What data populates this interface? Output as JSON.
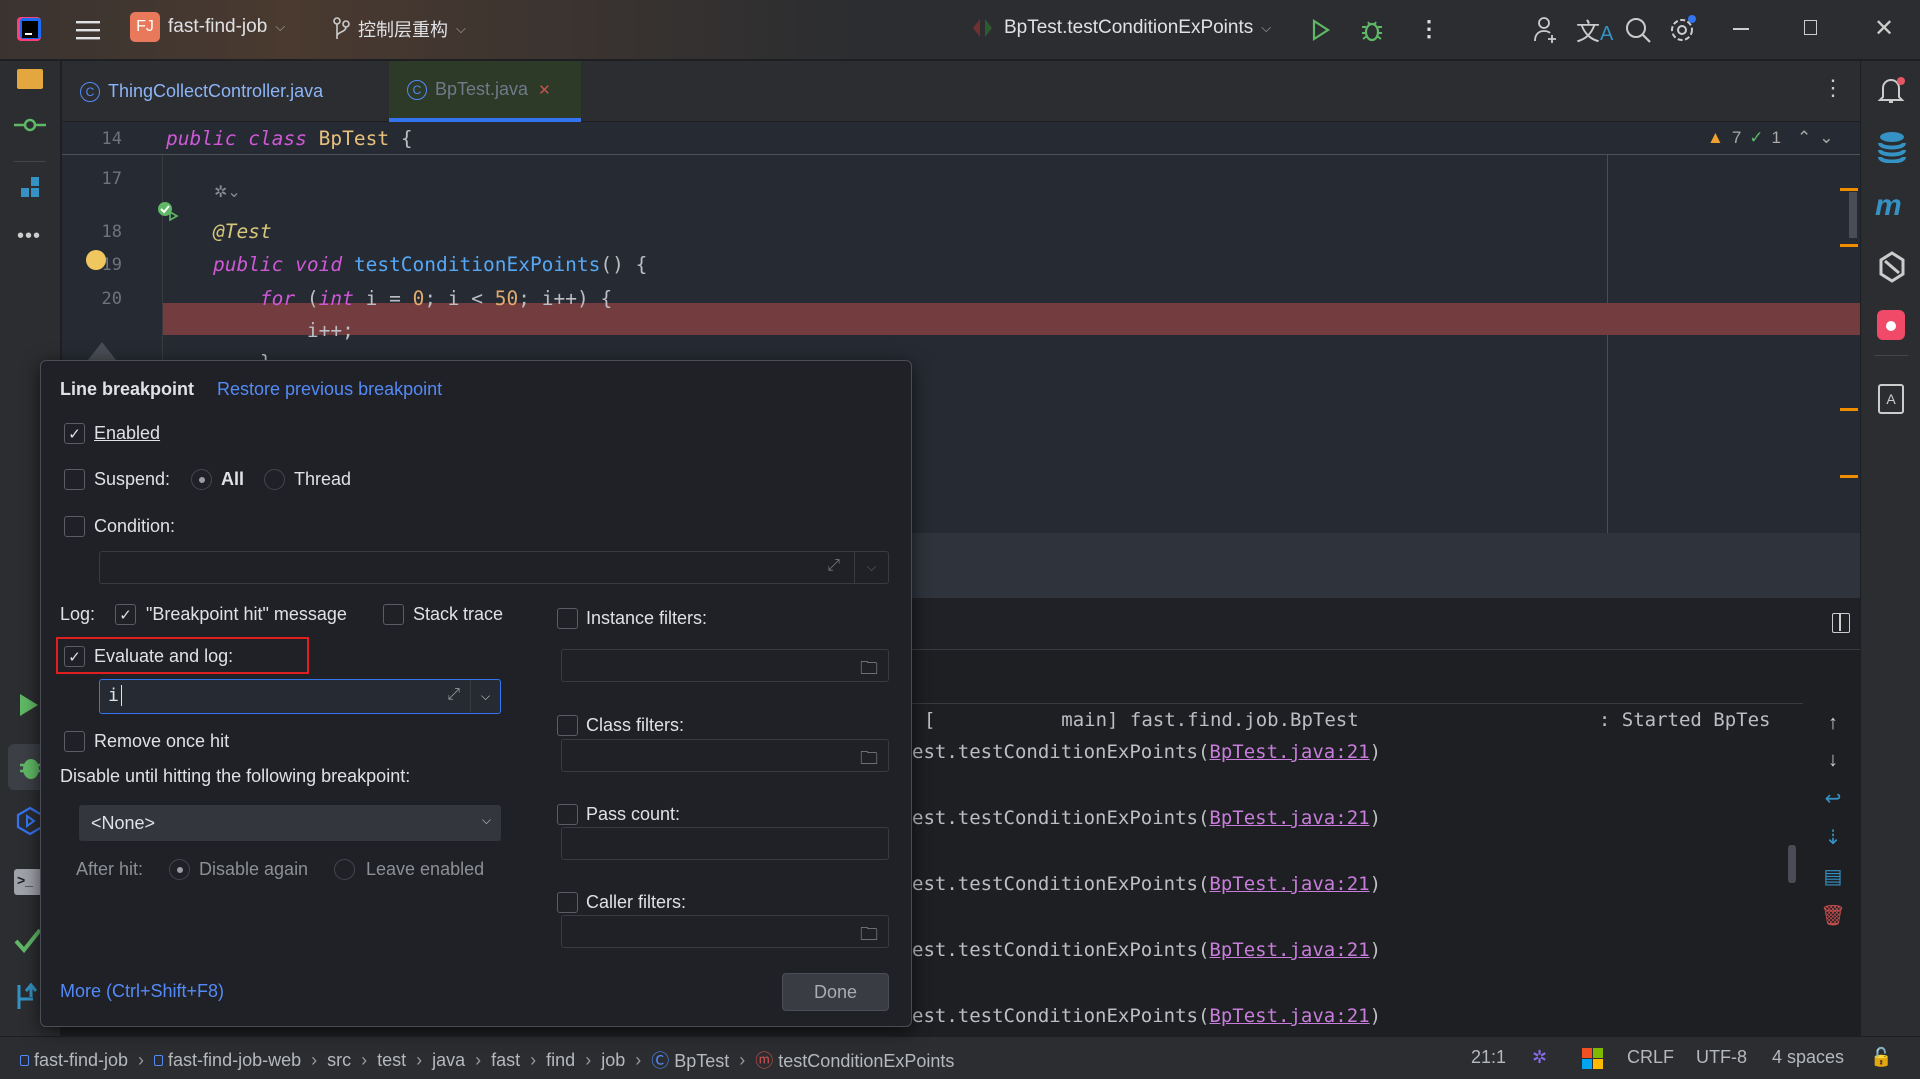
{
  "titlebar": {
    "project_badge": "FJ",
    "project_name": "fast-find-job",
    "branch": "控制层重构",
    "run_config": "BpTest.testConditionExPoints",
    "icons": [
      "app-logo-icon",
      "hamburger-menu-icon",
      "branch-icon",
      "run-icon",
      "debug-icon",
      "more-icon",
      "add-user-icon",
      "translate-icon",
      "search-icon",
      "settings-icon",
      "minimize-icon",
      "restore-icon",
      "close-icon"
    ]
  },
  "tabs": [
    {
      "label": "ThingCollectController.java",
      "active": false
    },
    {
      "label": "BpTest.java",
      "active": true,
      "close": "✕"
    }
  ],
  "editor": {
    "sticky": {
      "line": "14",
      "tokens": [
        {
          "t": "public ",
          "c": "kw"
        },
        {
          "t": "class ",
          "c": "kw"
        },
        {
          "t": "BpTest",
          "c": "cls"
        },
        {
          "t": " {",
          "c": "pl"
        }
      ]
    },
    "inspections": {
      "warnings": "7",
      "ok": "1"
    },
    "lines": [
      {
        "num": "17",
        "tokens": []
      },
      {
        "num": "18",
        "tokens": [
          {
            "t": "    @Test",
            "c": "ann"
          }
        ]
      },
      {
        "num": "19",
        "tokens": [
          {
            "t": "    public ",
            "c": "kw"
          },
          {
            "t": "void ",
            "c": "kw"
          },
          {
            "t": "testConditionExPoints",
            "c": "fn"
          },
          {
            "t": "() {",
            "c": "pl"
          }
        ]
      },
      {
        "num": "20",
        "tokens": [
          {
            "t": "        for ",
            "c": "kw"
          },
          {
            "t": "(",
            "c": "pl"
          },
          {
            "t": "int ",
            "c": "kw"
          },
          {
            "t": "i = ",
            "c": "pl"
          },
          {
            "t": "0",
            "c": "num"
          },
          {
            "t": "; i < ",
            "c": "pl"
          },
          {
            "t": "50",
            "c": "num"
          },
          {
            "t": "; i++) {",
            "c": "pl"
          }
        ]
      },
      {
        "num": "",
        "tokens": [
          {
            "t": "            i++;",
            "c": "pl"
          }
        ],
        "breakpoint": true
      },
      {
        "num": "",
        "tokens": [
          {
            "t": "        }",
            "c": "pl"
          }
        ]
      }
    ]
  },
  "console": {
    "header_line": "[           main] fast.find.job.BpTest                     : Started BpTes",
    "lines": [
      {
        "prefix": "est.testConditionExPoints(",
        "link": "BpTest.java:21",
        "suffix": ")"
      },
      {
        "prefix": "est.testConditionExPoints(",
        "link": "BpTest.java:21",
        "suffix": ")"
      },
      {
        "prefix": "est.testConditionExPoints(",
        "link": "BpTest.java:21",
        "suffix": ")"
      },
      {
        "prefix": "est.testConditionExPoints(",
        "link": "BpTest.java:21",
        "suffix": ")"
      },
      {
        "prefix": "est.testConditionExPoints(",
        "link": "BpTest.java:21",
        "suffix": ")"
      }
    ]
  },
  "dialog": {
    "title": "Line breakpoint",
    "restore_link": "Restore previous breakpoint",
    "enabled": {
      "label": "Enabled",
      "checked": true
    },
    "suspend": {
      "label": "Suspend:",
      "checked": false,
      "options": [
        "All",
        "Thread"
      ],
      "selected": "All"
    },
    "condition": {
      "label": "Condition:",
      "checked": false,
      "value": ""
    },
    "log_label": "Log:",
    "log_message": {
      "label": "\"Breakpoint hit\" message",
      "checked": true
    },
    "stack_trace": {
      "label": "Stack trace",
      "checked": false
    },
    "evaluate_and_log": {
      "label": "Evaluate and log:",
      "checked": true,
      "value": "i",
      "highlight_color": "#e02020"
    },
    "remove_once_hit": {
      "label": "Remove once hit",
      "checked": false
    },
    "disable_until_label": "Disable until hitting the following breakpoint:",
    "disable_until_value": "<None>",
    "after_hit": {
      "label": "After hit:",
      "options": [
        "Disable again",
        "Leave enabled"
      ],
      "selected": "Disable again"
    },
    "instance_filters": {
      "label": "Instance filters:",
      "checked": false
    },
    "class_filters": {
      "label": "Class filters:",
      "checked": false
    },
    "pass_count": {
      "label": "Pass count:",
      "checked": false
    },
    "caller_filters": {
      "label": "Caller filters:",
      "checked": false
    },
    "more_link": "More (Ctrl+Shift+F8)",
    "done": "Done"
  },
  "statusbar": {
    "breadcrumbs": [
      "fast-find-job",
      "fast-find-job-web",
      "src",
      "test",
      "java",
      "fast",
      "find",
      "job",
      "BpTest",
      "testConditionExPoints"
    ],
    "position": "21:1",
    "line_ending": "CRLF",
    "encoding": "UTF-8",
    "indent": "4 spaces"
  },
  "colors": {
    "accent": "#3574f0",
    "breakpoint_line": "#733d3f",
    "breakpoint": "#f0c75e"
  }
}
